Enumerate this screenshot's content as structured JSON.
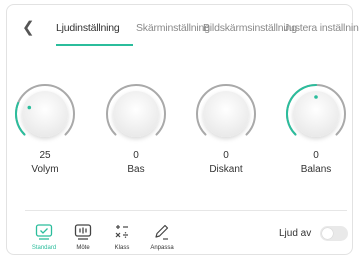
{
  "accent_color": "#2bbd9c",
  "tabs": [
    {
      "label": "Ljudinställning",
      "active": true
    },
    {
      "label": "Skärminställning",
      "active": false
    },
    {
      "label": "Bildskärmsinställning",
      "active": false
    },
    {
      "label": "Justera inställning",
      "active": false
    }
  ],
  "knobs": [
    {
      "label": "Volym",
      "value": "25",
      "level": 0.25
    },
    {
      "label": "Bas",
      "value": "0",
      "level": 0
    },
    {
      "label": "Diskant",
      "value": "0",
      "level": 0
    },
    {
      "label": "Balans",
      "value": "0",
      "level": 0.5
    }
  ],
  "modes": [
    {
      "label": "Standard",
      "icon": "standard-mode-icon",
      "active": true
    },
    {
      "label": "Möte",
      "icon": "meeting-mode-icon",
      "active": false
    },
    {
      "label": "Klass",
      "icon": "class-mode-icon",
      "active": false
    },
    {
      "label": "Anpassa",
      "icon": "customize-mode-icon",
      "active": false
    }
  ],
  "mute": {
    "label": "Ljud av",
    "on": false
  },
  "back_icon": "chevron-left-icon"
}
